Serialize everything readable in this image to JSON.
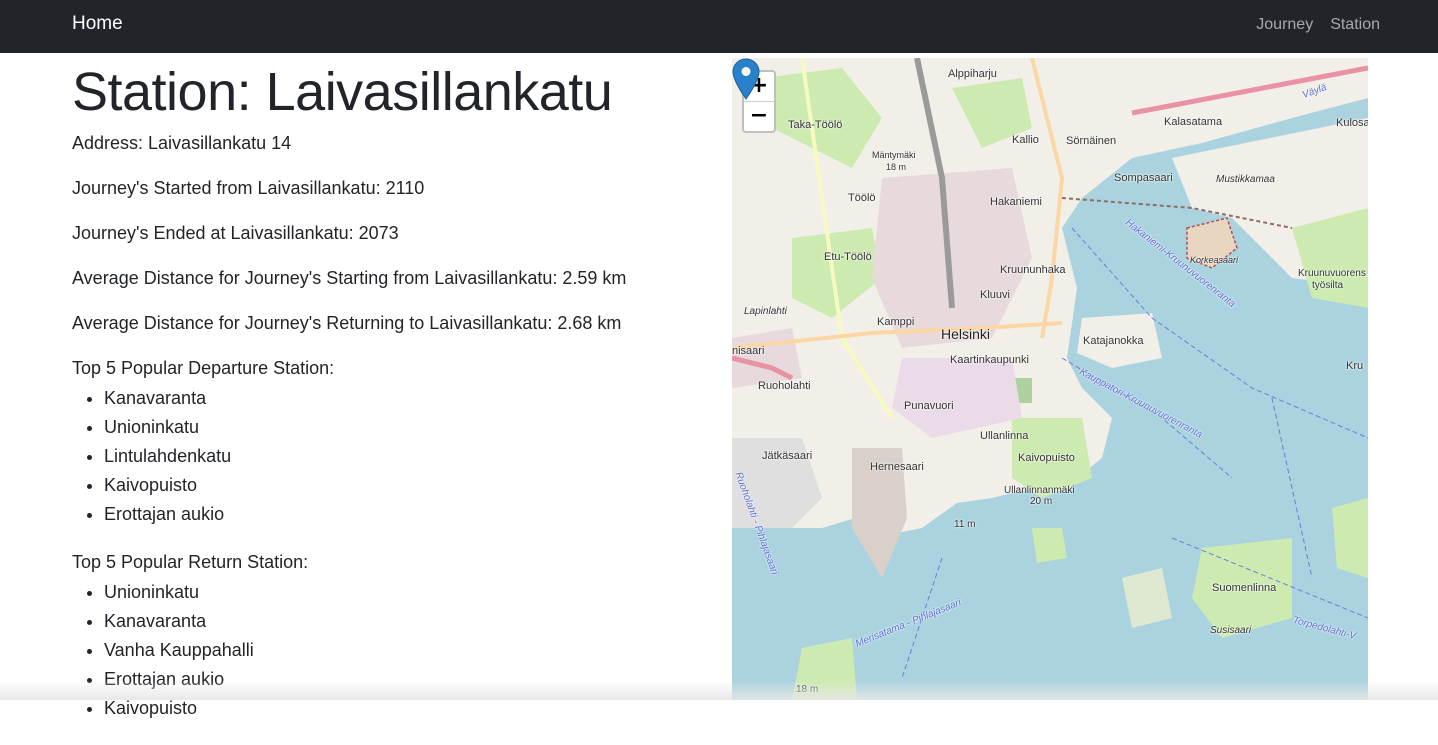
{
  "navbar": {
    "brand": "Home",
    "links": [
      "Journey",
      "Station"
    ]
  },
  "station": {
    "title": "Station: Laivasillankatu",
    "address": "Address: Laivasillankatu 14",
    "journeys_started": "Journey's Started from Laivasillankatu: 2110",
    "journeys_ended": "Journey's Ended at Laivasillankatu: 2073",
    "avg_distance_start": "Average Distance for Journey's Starting from Laivasillankatu: 2.59 km",
    "avg_distance_return": "Average Distance for Journey's Returning to Laivasillankatu: 2.68 km",
    "top_departure_title": "Top 5 Popular Departure Station:",
    "top_departure": [
      "Kanavaranta",
      "Unioninkatu",
      "Lintulahdenkatu",
      "Kaivopuisto",
      "Erottajan aukio"
    ],
    "top_return_title": "Top 5 Popular Return Station:",
    "top_return": [
      "Unioninkatu",
      "Kanavaranta",
      "Vanha Kauppahalli",
      "Erottajan aukio",
      "Kaivopuisto"
    ]
  },
  "map": {
    "zoom_in": "+",
    "zoom_out": "−",
    "marker_color": "#2a81cb",
    "labels": {
      "alppiharju": "Alppiharju",
      "taka_toolo": "Taka-Töölö",
      "kallio": "Kallio",
      "sornainen": "Sörnäinen",
      "kalasatama": "Kalasatama",
      "kulosaari": "Kulosa",
      "mantymaki": "Mäntymäki",
      "mantymaki_elev": "18 m",
      "toolo": "Töölö",
      "hakaniemi": "Hakaniemi",
      "sompasaari": "Sompasaari",
      "mustikkamaa": "Mustikkamaa",
      "etu_toolo": "Etu-Töölö",
      "kruununhaka": "Kruununhaka",
      "korkeasaari": "Korkeasaari",
      "kluuvi": "Kluuvi",
      "lapinlahti": "Lapinlahti",
      "kamppi": "Kamppi",
      "helsinki": "Helsinki",
      "katajanokka": "Katajanokka",
      "kaartinkaupunki": "Kaartinkaupunki",
      "ruoholahti": "Ruoholahti",
      "punavuori": "Punavuori",
      "ullanlinna": "Ullanlinna",
      "jatkasaari": "Jätkäsaari",
      "hernesaari": "Hernesaari",
      "kaivopuisto": "Kaivopuisto",
      "ullanlinnanmaki": "Ullanlinnanmäki",
      "ullanlinnanmaki_elev": "20 m",
      "elev_11": "11 m",
      "suomenlinna": "Suomenlinna",
      "susisaari": "Susisaari",
      "elev_18": "18 m",
      "kruunuvuorensaari": "Kruunuvuorens",
      "tyosilta": "työsilta",
      "kru": "Kru",
      "hakaniemi_route": "Hakaniemi-Kruunuvuorenranta",
      "kauppatori_route": "Kauppatori-Kruunuvuorenranta",
      "merisatama_route": "Merisatama - Pihlajasaari",
      "torpedolahti": "Torpedolahti-V",
      "vavlaya": "Väylä",
      "ruoholahti_route": "Ruoholahti - Pihlajasaari",
      "kaisaniemi": "nisaari"
    }
  }
}
